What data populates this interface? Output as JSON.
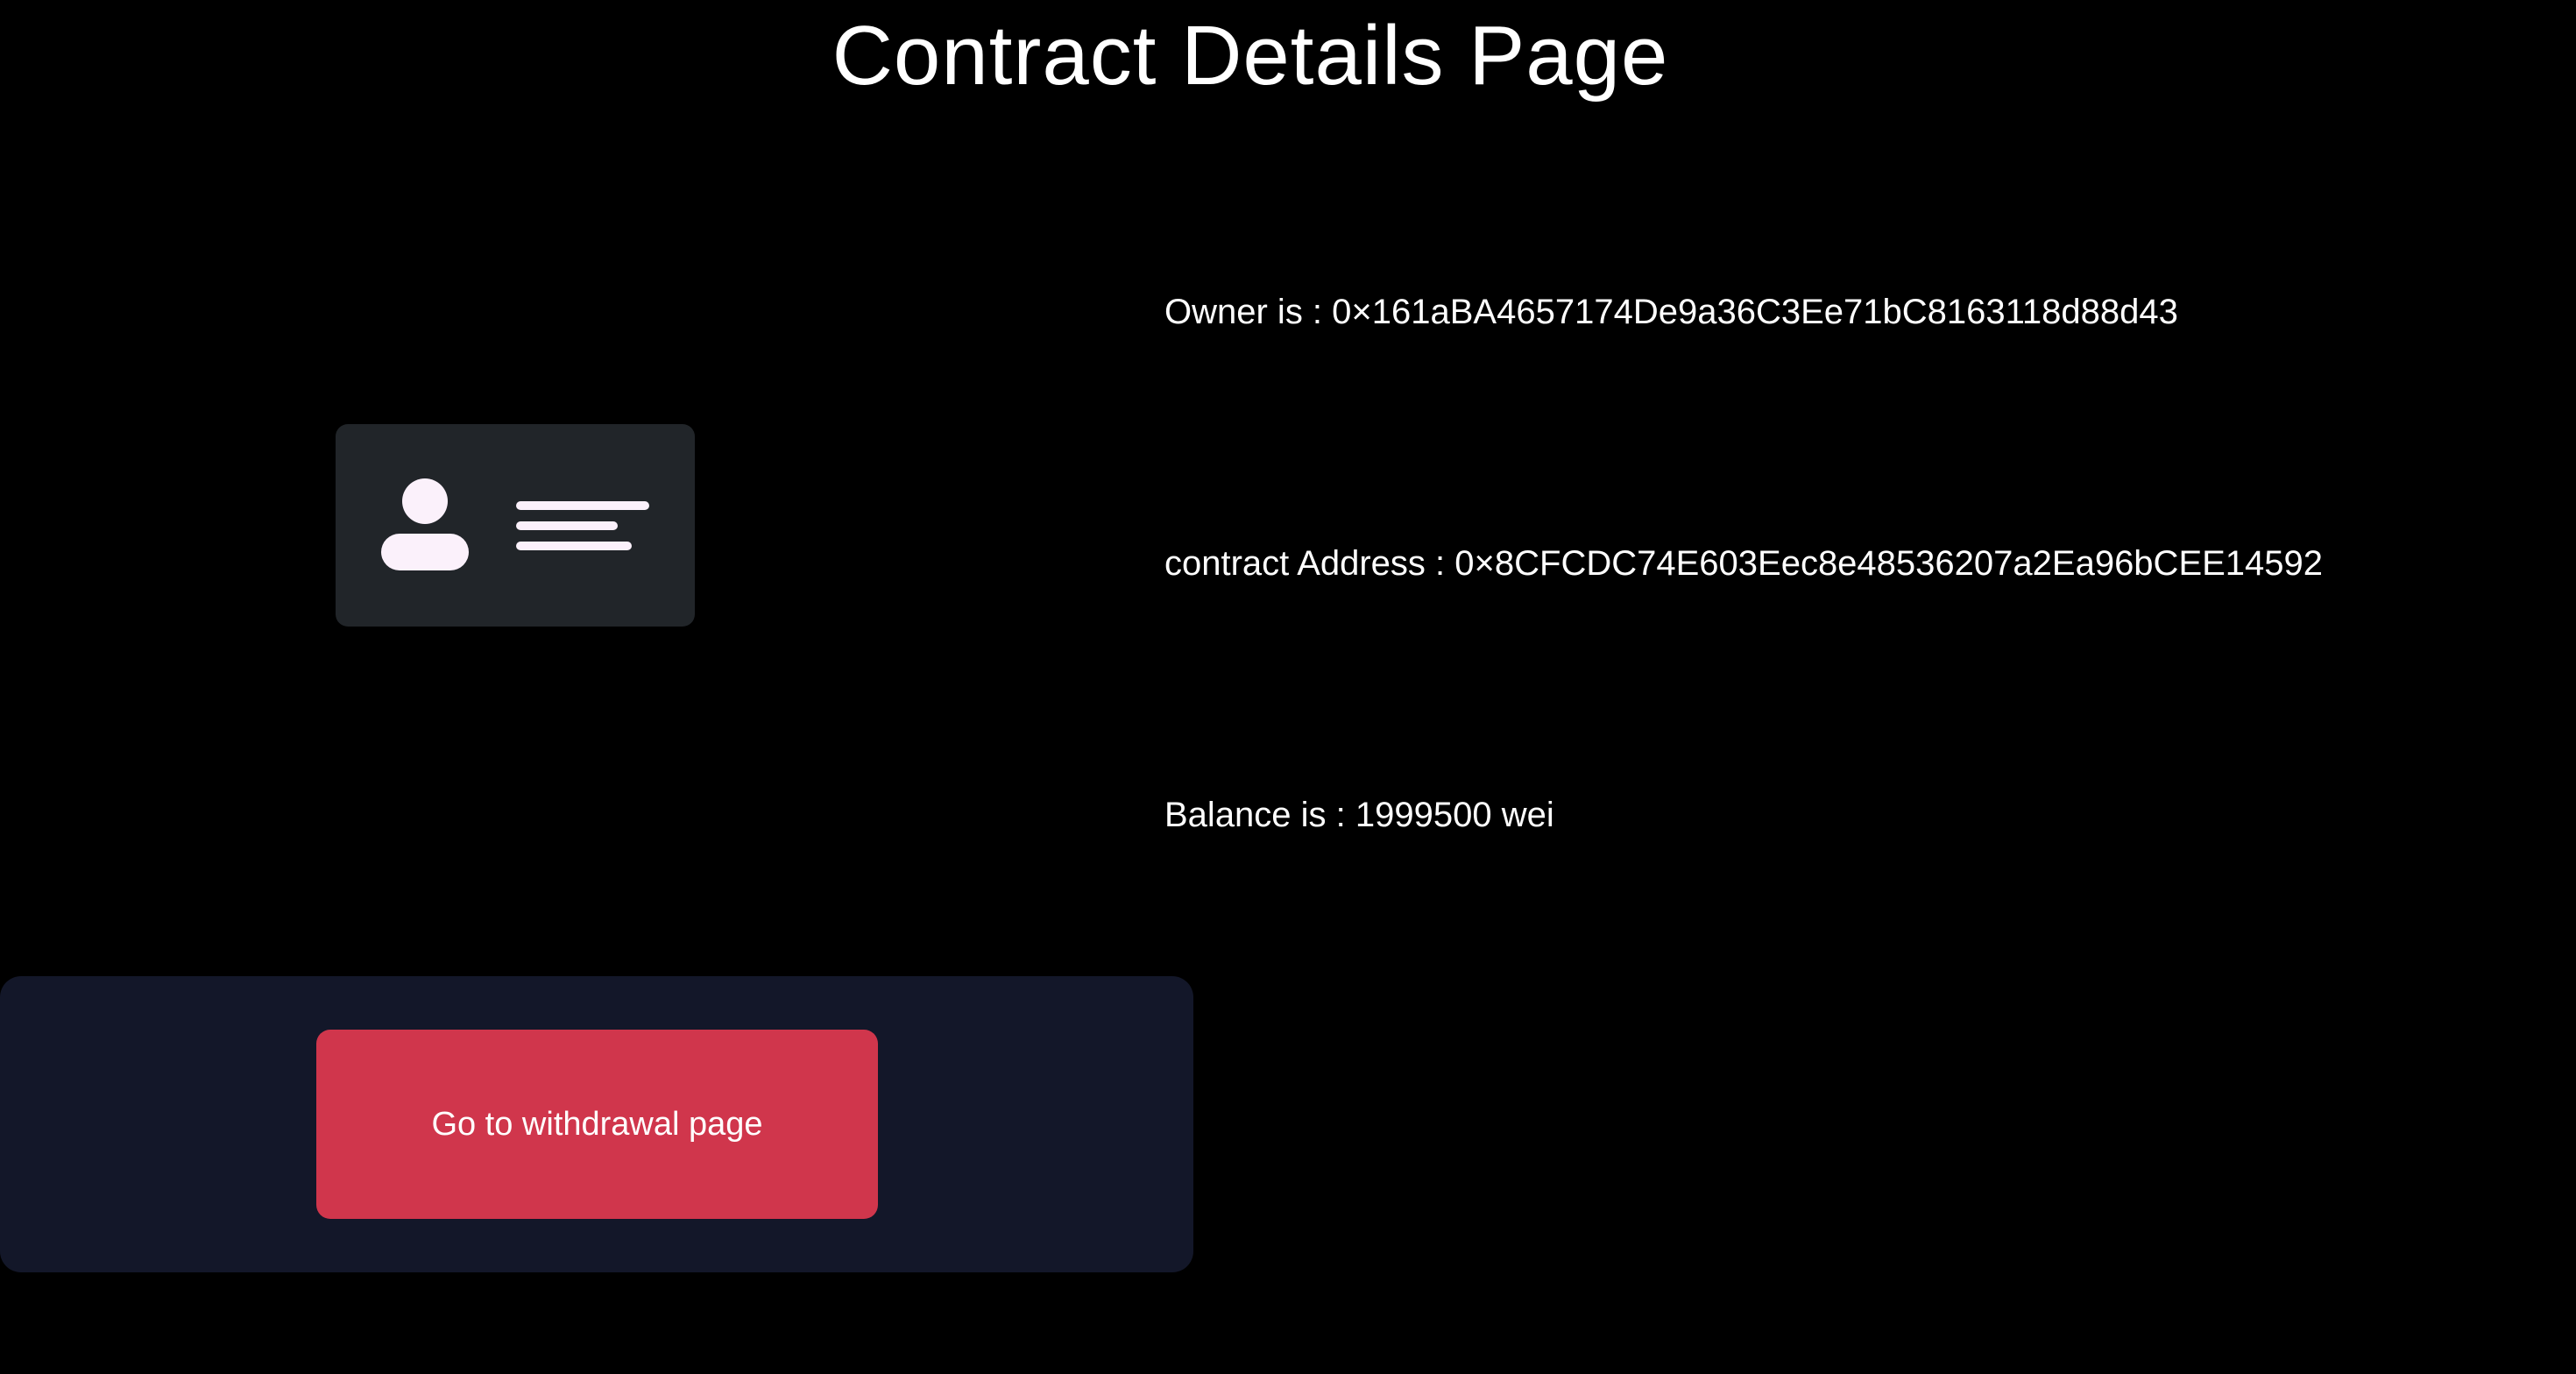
{
  "page": {
    "title": "Contract Details Page"
  },
  "details": {
    "owner": "Owner is : 0×161aBA4657174De9a36C3Ee71bC8163118d88d43",
    "contract_address": "contract Address : 0×8CFCDC74E603Eec8e48536207a2Ea96bCEE14592",
    "balance": "Balance is : 1999500 wei"
  },
  "actions": {
    "withdraw_label": "Go to withdrawal page"
  },
  "icons": {
    "id_card": "id-card-icon"
  },
  "colors": {
    "background": "#000000",
    "card": "#212529",
    "card_glyph": "#fbf1fb",
    "panel": "#131729",
    "button": "#d0364c",
    "text": "#ffffff"
  }
}
